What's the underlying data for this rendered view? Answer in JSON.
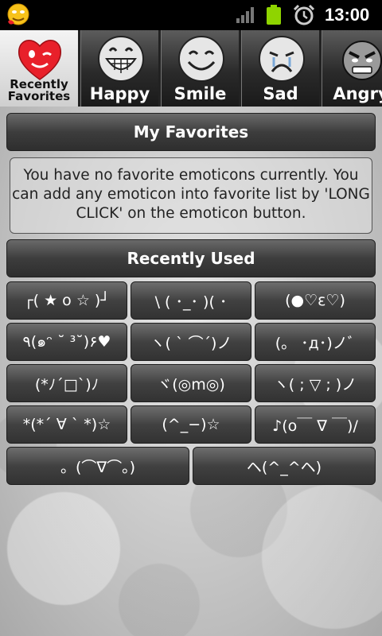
{
  "status_bar": {
    "time": "13:00",
    "icons": [
      "emoticon-app-icon",
      "signal-icon",
      "battery-icon",
      "alarm-icon"
    ]
  },
  "tabs": [
    {
      "label": "Recently Favorites",
      "icon": "heart-wink-face-icon",
      "active": true
    },
    {
      "label": "Happy",
      "icon": "grin-face-icon",
      "active": false
    },
    {
      "label": "Smile",
      "icon": "smile-face-icon",
      "active": false
    },
    {
      "label": "Sad",
      "icon": "sad-face-icon",
      "active": false
    },
    {
      "label": "Angry",
      "icon": "angry-face-icon",
      "active": false
    }
  ],
  "favorites": {
    "title": "My Favorites",
    "empty_message": "You have no favorite emoticons currently. You can add any emoticon into favorite list by 'LONG CLICK' on the emoticon button."
  },
  "recent": {
    "title": "Recently Used",
    "emoticons": [
      "┌( ★ o ☆ )┘",
      "\\ ( ･_･ )( ･",
      "(●♡ε♡)",
      "٩(๑ᵔ ˘ ³˘)۶♥",
      "ヽ( ` ⌒´)ノ",
      "(。 ･д･)ノﾞ",
      "(*ﾉ´□`)ﾉ",
      "ヾ(◎m◎)",
      "ヽ( ; ▽ ; )ノ",
      "*(*´ ∀ ` *)☆",
      "(^_−)☆",
      "♪(o￣ ∇ ￣)/",
      "。(⌒∇⌒。)",
      "ヘ(^_^ヘ)"
    ]
  },
  "colors": {
    "status_bar": "#000000",
    "header_bg": "#3d3d3d",
    "button_bg": "#414141",
    "active_tab_bg": "#e0e0e0",
    "heart_red": "#e8202a"
  }
}
